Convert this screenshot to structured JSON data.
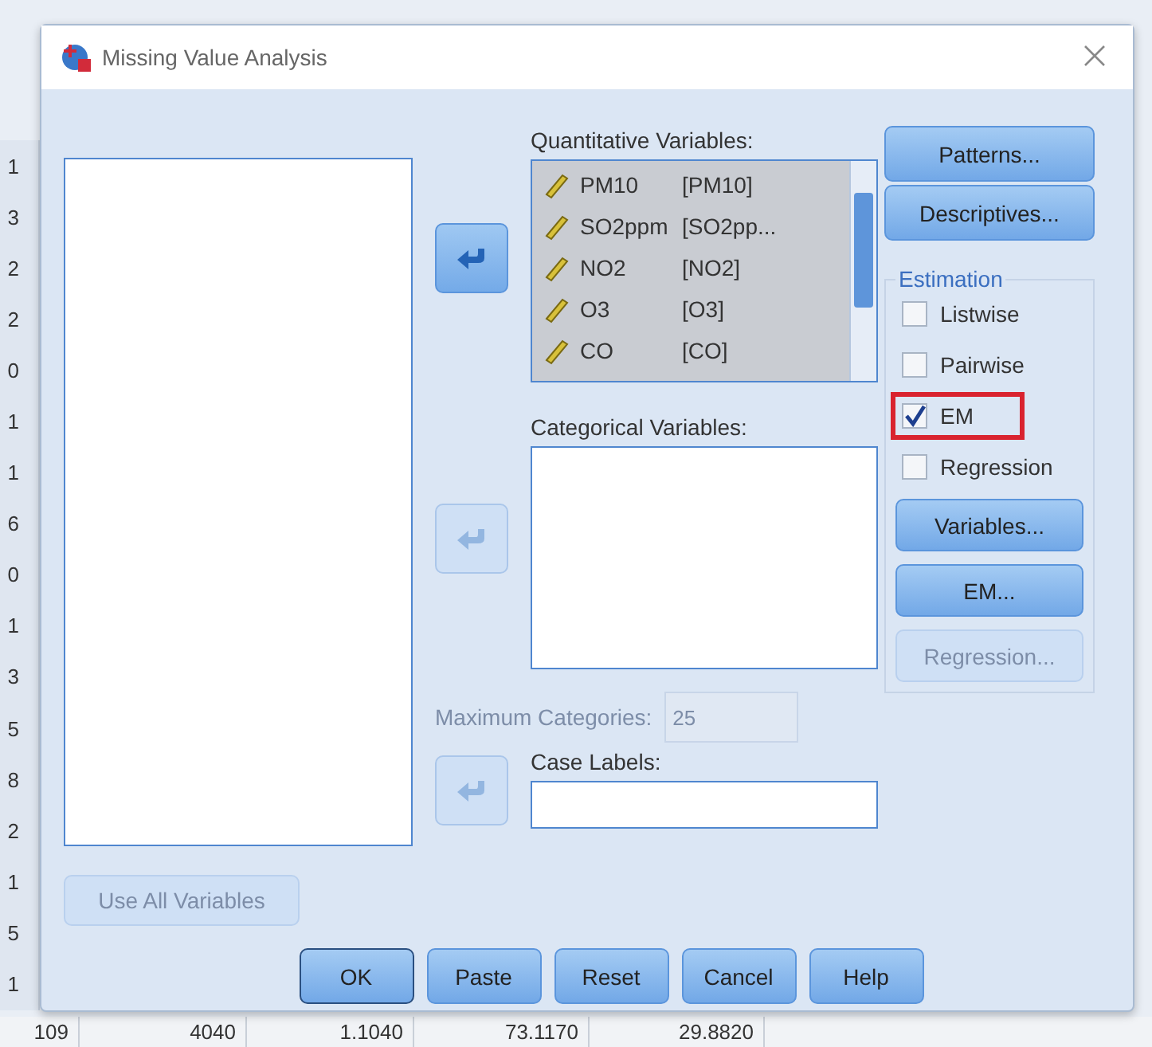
{
  "window": {
    "title": "Missing Value Analysis"
  },
  "move_buttons": [
    {
      "disabled": false
    },
    {
      "disabled": true
    },
    {
      "disabled": true
    }
  ],
  "quantitative": {
    "label": "Quantitative Variables:",
    "items": [
      {
        "name": "PM10",
        "label": "[PM10]"
      },
      {
        "name": "SO2ppm",
        "label": "[SO2pp..."
      },
      {
        "name": "NO2",
        "label": "[NO2]"
      },
      {
        "name": "O3",
        "label": "[O3]"
      },
      {
        "name": "CO",
        "label": "[CO]"
      }
    ]
  },
  "categorical": {
    "label": "Categorical Variables:"
  },
  "max_categories": {
    "label": "Maximum Categories:",
    "value": "25",
    "disabled": true
  },
  "case_labels": {
    "label": "Case Labels:"
  },
  "use_all_button": {
    "label": "Use All Variables",
    "disabled": true
  },
  "side_buttons": [
    {
      "label": "Patterns..."
    },
    {
      "label": "Descriptives..."
    }
  ],
  "estimation": {
    "title": "Estimation",
    "options": [
      {
        "label": "Listwise",
        "checked": false,
        "highlighted": false
      },
      {
        "label": "Pairwise",
        "checked": false,
        "highlighted": false
      },
      {
        "label": "EM",
        "checked": true,
        "highlighted": true
      },
      {
        "label": "Regression",
        "checked": false,
        "highlighted": false
      }
    ],
    "buttons": [
      {
        "label": "Variables...",
        "disabled": false
      },
      {
        "label": "EM...",
        "disabled": false
      },
      {
        "label": "Regression...",
        "disabled": true
      }
    ]
  },
  "footer_buttons": [
    {
      "label": "OK",
      "default": true
    },
    {
      "label": "Paste",
      "default": false
    },
    {
      "label": "Reset",
      "default": false
    },
    {
      "label": "Cancel",
      "default": false
    },
    {
      "label": "Help",
      "default": false
    }
  ],
  "background_sheet": {
    "row_cells": [
      "1",
      "3",
      "2",
      "2",
      "0",
      "1",
      "1",
      "6",
      "0",
      "1",
      "3",
      "5",
      "8",
      "2",
      "1",
      "5",
      "1"
    ],
    "bottom_row": [
      "109",
      "4040",
      "1.1040",
      "73.1170",
      "29.8820"
    ]
  }
}
